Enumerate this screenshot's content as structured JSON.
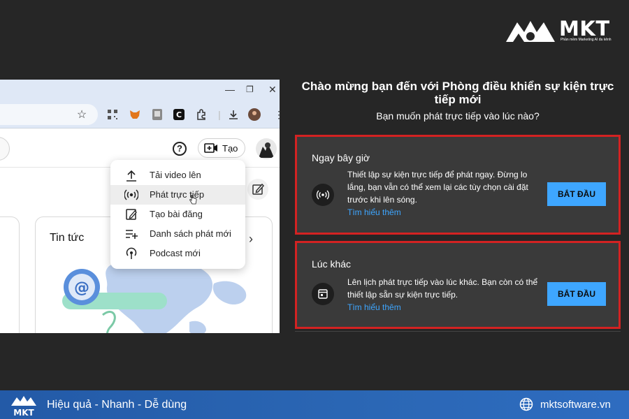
{
  "brand": {
    "wordmark": "MKT",
    "tagline": "Phần mềm Marketing AI đa kênh"
  },
  "browser": {
    "create_label": "Tạo",
    "help_symbol": "?",
    "card_title": "Tin tức",
    "menu": [
      {
        "label": "Tải video lên",
        "icon": "upload-icon"
      },
      {
        "label": "Phát trực tiếp",
        "icon": "live-broadcast-icon"
      },
      {
        "label": "Tạo bài đăng",
        "icon": "edit-post-icon"
      },
      {
        "label": "Danh sách phát mới",
        "icon": "playlist-add-icon"
      },
      {
        "label": "Podcast mới",
        "icon": "podcast-icon"
      }
    ]
  },
  "dialog": {
    "title": "Chào mừng bạn đến với Phòng điều khiển sự kiện trực tiếp mới",
    "subtitle": "Bạn muốn phát trực tiếp vào lúc nào?",
    "options": [
      {
        "heading": "Ngay bây giờ",
        "description": "Thiết lập sự kiện trực tiếp để phát ngay. Đừng lo lắng, bạn vẫn có thể xem lại các tùy chọn cài đặt trước khi lên sóng.",
        "link": "Tìm hiểu thêm",
        "button": "BẮT ĐẦU",
        "icon": "live-broadcast-icon"
      },
      {
        "heading": "Lúc khác",
        "description": "Lên lịch phát trực tiếp vào lúc khác. Bạn còn có thể thiết lập sẵn sự kiện trực tiếp.",
        "link": "Tìm hiểu thêm",
        "button": "BẮT ĐẦU",
        "icon": "calendar-icon"
      }
    ],
    "highlight_color": "#d32222",
    "button_color": "#3ea6ff"
  },
  "footer": {
    "slogan": "Hiệu quả - Nhanh - Dễ dùng",
    "website": "mktsoftware.vn"
  }
}
